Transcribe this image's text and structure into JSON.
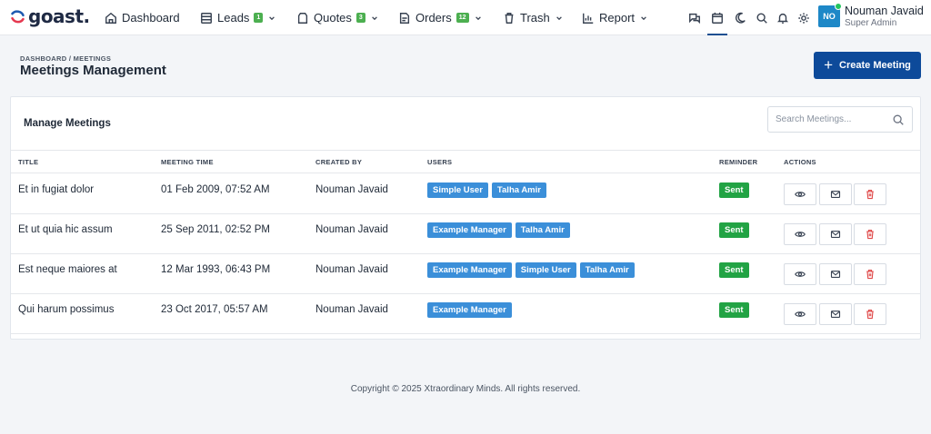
{
  "brand": {
    "name": "goast."
  },
  "nav": [
    {
      "label": "Dashboard",
      "icon": "home-icon",
      "badge": ""
    },
    {
      "label": "Leads",
      "icon": "list-icon",
      "badge": "1"
    },
    {
      "label": "Quotes",
      "icon": "quote-icon",
      "badge": "3"
    },
    {
      "label": "Orders",
      "icon": "orders-icon",
      "badge": "12"
    },
    {
      "label": "Trash",
      "icon": "trash-icon",
      "badge": ""
    },
    {
      "label": "Report",
      "icon": "chart-icon",
      "badge": ""
    }
  ],
  "user": {
    "initials": "NO",
    "name": "Nouman Javaid",
    "role": "Super Admin"
  },
  "header": {
    "breadcrumb": "DASHBOARD / MEETINGS",
    "title": "Meetings Management",
    "create_label": "Create Meeting"
  },
  "card": {
    "title": "Manage Meetings",
    "search_placeholder": "Search Meetings..."
  },
  "table": {
    "columns": [
      "TITLE",
      "MEETING TIME",
      "CREATED BY",
      "USERS",
      "REMINDER",
      "ACTIONS"
    ],
    "rows": [
      {
        "title": "Et in fugiat dolor",
        "time": "01 Feb 2009, 07:52 AM",
        "created_by": "Nouman Javaid",
        "users": [
          "Simple User",
          "Talha Amir"
        ],
        "reminder": "Sent"
      },
      {
        "title": "Et ut quia hic assum",
        "time": "25 Sep 2011, 02:52 PM",
        "created_by": "Nouman Javaid",
        "users": [
          "Example Manager",
          "Talha Amir"
        ],
        "reminder": "Sent"
      },
      {
        "title": "Est neque maiores at",
        "time": "12 Mar 1993, 06:43 PM",
        "created_by": "Nouman Javaid",
        "users": [
          "Example Manager",
          "Simple User",
          "Talha Amir"
        ],
        "reminder": "Sent"
      },
      {
        "title": "Qui harum possimus",
        "time": "23 Oct 2017, 05:57 AM",
        "created_by": "Nouman Javaid",
        "users": [
          "Example Manager"
        ],
        "reminder": "Sent"
      }
    ]
  },
  "footer": {
    "text": "Copyright © 2025 Xtraordinary Minds. All rights reserved."
  },
  "colors": {
    "primary": "#0d4a9a",
    "tag": "#3b8fd9",
    "sent": "#22a344",
    "delete": "#e04848"
  }
}
